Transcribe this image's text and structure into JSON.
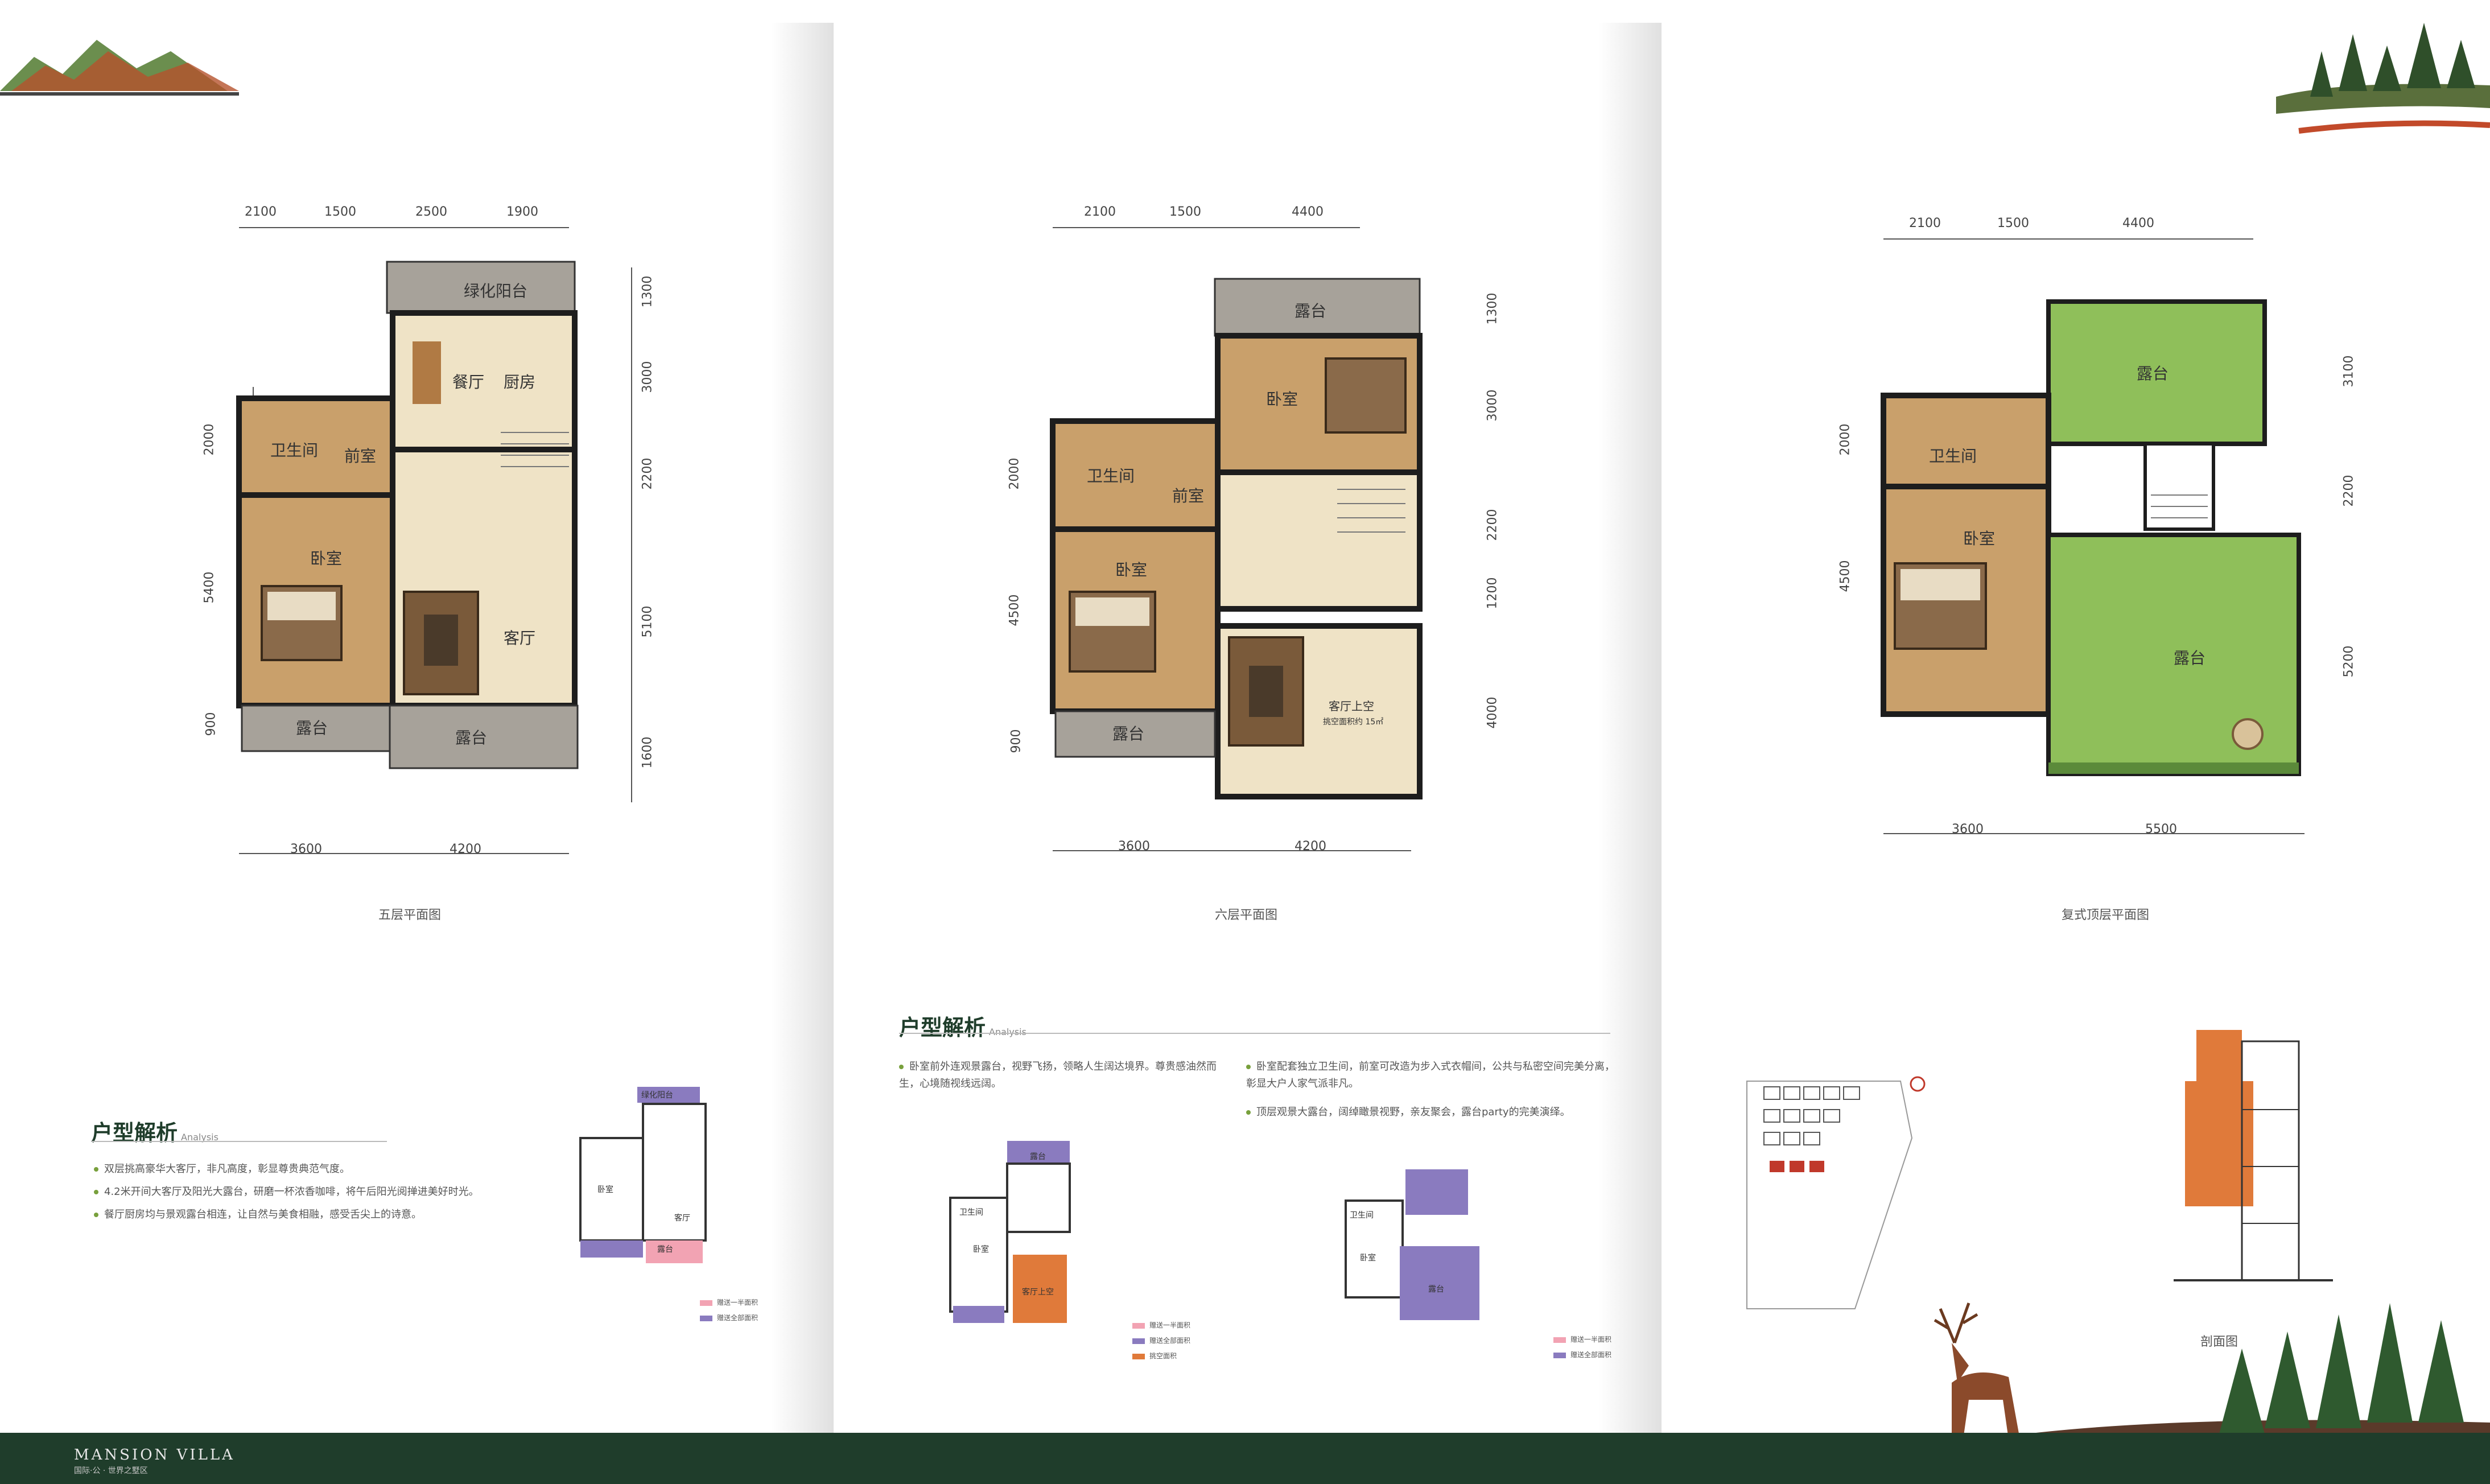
{
  "colors": {
    "wood": "#c9a06b",
    "tile": "#efe3c6",
    "wall": "#1d1d1d",
    "lawn": "#8fbf5a",
    "deck": "#a7a29a",
    "footer": "#1f3d2b",
    "pink": "#f2a3b3",
    "purple": "#8a7bbf",
    "orange": "#e07a3a"
  },
  "floor5": {
    "title": "五层平面图",
    "top_dims": [
      "2100",
      "1500",
      "2500",
      "1900"
    ],
    "bottom_dims": [
      "3600",
      "4200"
    ],
    "left_dims": [
      "2000",
      "5400",
      "900"
    ],
    "right_dims": [
      "1300",
      "3000",
      "2200",
      "5100",
      "1600"
    ],
    "rooms": {
      "green_balcony": "绿化阳台",
      "dining": "餐厅",
      "kitchen": "厨房",
      "bath": "卫生间",
      "front": "前室",
      "bedroom": "卧室",
      "living": "客厅",
      "terrace_left": "露台",
      "terrace_bottom": "露台"
    }
  },
  "floor6": {
    "title": "六层平面图",
    "top_dims": [
      "2100",
      "1500",
      "4400"
    ],
    "bottom_dims": [
      "3600",
      "4200"
    ],
    "left_dims": [
      "2000",
      "4500",
      "900"
    ],
    "right_dims": [
      "1300",
      "3000",
      "2200",
      "1200",
      "4000"
    ],
    "rooms": {
      "terrace_top": "露台",
      "bedroom_top": "卧室",
      "bath": "卫生间",
      "front": "前室",
      "bedroom": "卧室",
      "void": "客厅上空",
      "void_note": "挑空面积约 15㎡",
      "terrace_left": "露台"
    }
  },
  "floor7": {
    "title": "复式顶层平面图",
    "top_dims": [
      "2100",
      "1500",
      "4400"
    ],
    "bottom_dims": [
      "3600",
      "5500"
    ],
    "left_dims": [
      "2000",
      "4500"
    ],
    "right_dims": [
      "3100",
      "2200",
      "5200"
    ],
    "rooms": {
      "terrace_top": "露台",
      "bath": "卫生间",
      "bedroom": "卧室",
      "terrace_big": "露台"
    }
  },
  "analysis_left": {
    "title": "户型解析",
    "sub": "Analysis",
    "bullets": [
      "双层挑高豪华大客厅，非凡高度，彰显尊贵典范气度。",
      "4.2米开间大客厅及阳光大露台，研磨一杯浓香咖啡，将午后阳光阅掸进美好时光。",
      "餐厅厨房均与景观露台相连，让自然与美食相融，感受舌尖上的诗意。"
    ]
  },
  "analysis_mid": {
    "title": "户型解析",
    "sub": "Analysis",
    "bullets_a": [
      "卧室前外连观景露台，视野飞扬，领略人生阔达境界。尊贵感油然而生，心境随视线远阔。"
    ],
    "bullets_b": [
      "卧室配套独立卫生间，前室可改造为步入式衣帽间，公共与私密空间完美分离，彰显大户人家气派非凡。",
      "顶层观景大露台，阔绰瞰景视野，亲友聚会，露台party的完美演绎。"
    ]
  },
  "mini_labels": {
    "balcony": "绿化阳台",
    "bath": "卫生间",
    "front": "前室",
    "bedroom": "卧室",
    "dining": "餐厅",
    "kitchen": "厨房",
    "living": "客厅",
    "terrace": "露台",
    "void": "客厅上空"
  },
  "legend": {
    "gift": "赠送一半面积",
    "full": "赠送全部面积",
    "void": "挑空面积"
  },
  "section": {
    "title": "剖面图"
  },
  "brand": {
    "name": "MANSION VILLA",
    "sub": "国际·公 · 世界之墅区"
  }
}
